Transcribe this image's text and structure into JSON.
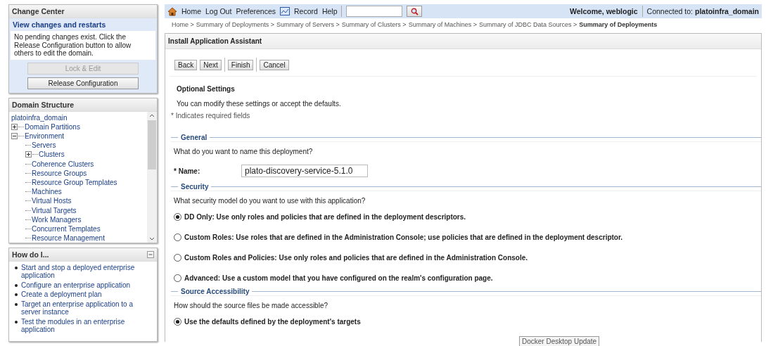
{
  "change_center": {
    "title": "Change Center",
    "link": "View changes and restarts",
    "message": "No pending changes exist. Click the Release Configuration button to allow others to edit the domain.",
    "buttons": [
      {
        "label": "Lock & Edit",
        "disabled": true
      },
      {
        "label": "Release Configuration",
        "disabled": false
      }
    ]
  },
  "domain_structure": {
    "title": "Domain Structure",
    "tree": [
      {
        "label": "platoinfra_domain",
        "children": [
          {
            "label": "Domain Partitions",
            "expanded": false
          },
          {
            "label": "Environment",
            "expanded": true,
            "children": [
              {
                "label": "Servers"
              },
              {
                "label": "Clusters",
                "expanded": false
              },
              {
                "label": "Coherence Clusters"
              },
              {
                "label": "Resource Groups"
              },
              {
                "label": "Resource Group Templates"
              },
              {
                "label": "Machines"
              },
              {
                "label": "Virtual Hosts"
              },
              {
                "label": "Virtual Targets"
              },
              {
                "label": "Work Managers"
              },
              {
                "label": "Concurrent Templates"
              },
              {
                "label": "Resource Management"
              }
            ]
          }
        ]
      }
    ]
  },
  "how_do_i": {
    "title": "How do I...",
    "items": [
      "Start and stop a deployed enterprise application",
      "Configure an enterprise application",
      "Create a deployment plan",
      "Target an enterprise application to a server instance",
      "Test the modules in an enterprise application"
    ]
  },
  "toolbar": {
    "links": [
      "Home",
      "Log Out",
      "Preferences",
      "Record",
      "Help"
    ],
    "welcome": "Welcome, weblogic",
    "connected_label": "Connected to:",
    "domain": "platoinfra_domain"
  },
  "breadcrumb": [
    "Home >",
    "Summary of Deployments >",
    "Summary of Servers >",
    "Summary of Clusters >",
    "Summary of Machines >",
    "Summary of JDBC Data Sources >",
    "Summary of Deployments"
  ],
  "assistant": {
    "title": "Install Application Assistant",
    "buttons": [
      "Back",
      "Next",
      "Finish",
      "Cancel"
    ],
    "heading": "Optional Settings",
    "intro": "You can modify these settings or accept the defaults.",
    "required_note": "* Indicates required fields",
    "sections": [
      {
        "title": "General",
        "question": "What do you want to name this deployment?",
        "kind": "field",
        "label": "* Name:",
        "value": "plato-discovery-service-5.1.0"
      },
      {
        "title": "Security",
        "question": "What security model do you want to use with this application?",
        "kind": "radios",
        "options": [
          {
            "label": "DD Only: Use only roles and policies that are defined in the deployment descriptors.",
            "selected": true
          },
          {
            "label": "Custom Roles: Use roles that are defined in the Administration Console; use policies that are defined in the deployment descriptor.",
            "selected": false
          },
          {
            "label": "Custom Roles and Policies: Use only roles and policies that are defined in the Administration Console.",
            "selected": false
          },
          {
            "label": "Advanced: Use a custom model that you have configured on the realm's configuration page.",
            "selected": false
          }
        ]
      },
      {
        "title": "Source Accessibility",
        "question": "How should the source files be made accessible?",
        "kind": "radios",
        "options": [
          {
            "label": "Use the defaults defined by the deployment's targets",
            "selected": true
          }
        ]
      }
    ]
  },
  "tooltip": "Docker Desktop Update"
}
